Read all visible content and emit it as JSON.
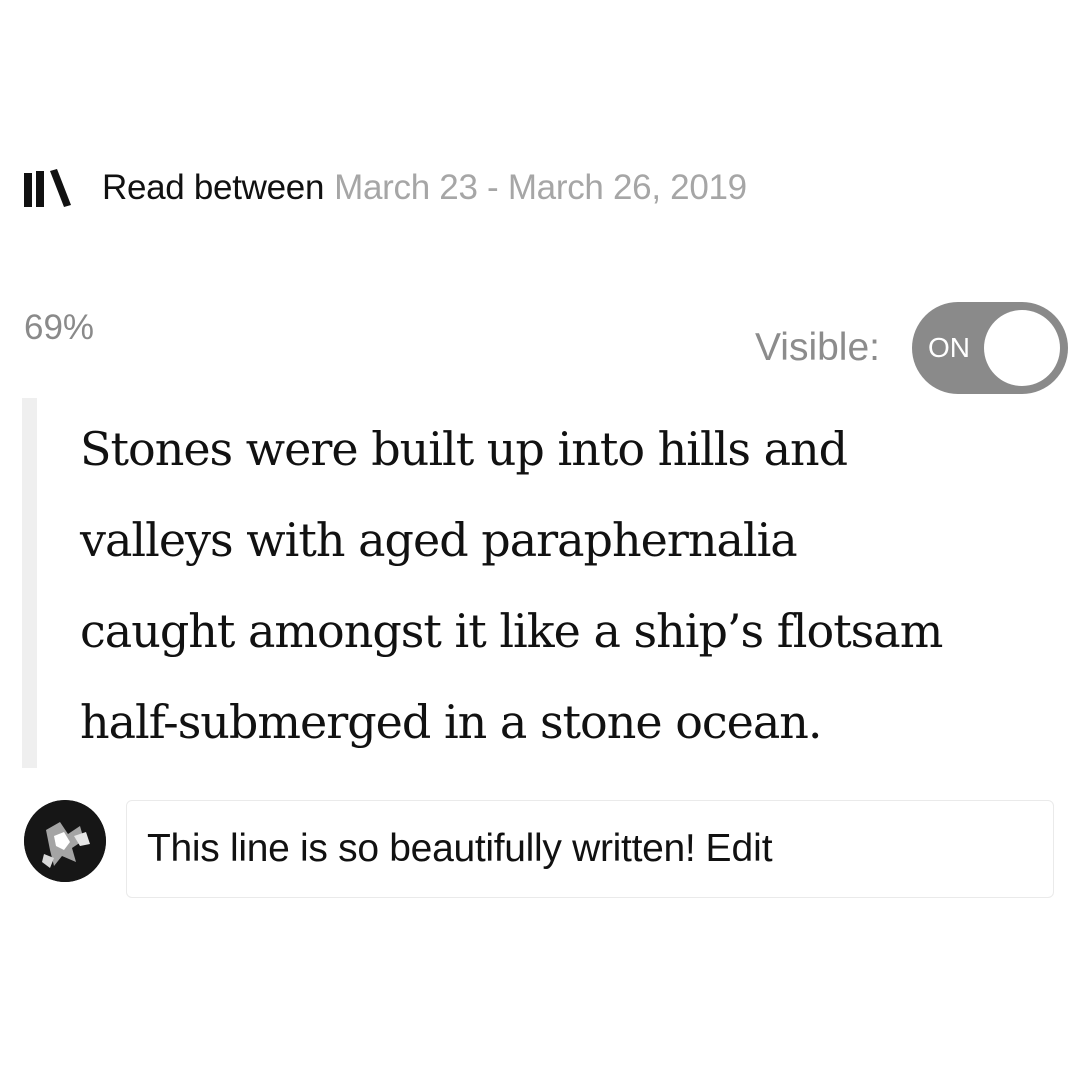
{
  "header": {
    "icon": "bookshelf-icon",
    "read_label": "Read between",
    "read_dates": "March 23 - March 26, 2019"
  },
  "progress": {
    "label": "69%",
    "value": 0.69
  },
  "visibility": {
    "label": "Visible:",
    "toggle_state": "ON",
    "is_on": true
  },
  "highlight": {
    "lines": [
      "Stones were built up into hills and",
      "valleys with aged paraphernalia",
      "caught amongst it like a ship’s flotsam",
      "half-submerged in a stone ocean."
    ]
  },
  "comment": {
    "avatar": "user-avatar",
    "text": "This line is so beautifully written!",
    "edit_label": "Edit"
  },
  "colors": {
    "toggle_on": "#8a8a8a",
    "date_text": "#a6a6a6",
    "quote_bar": "#efefef"
  }
}
